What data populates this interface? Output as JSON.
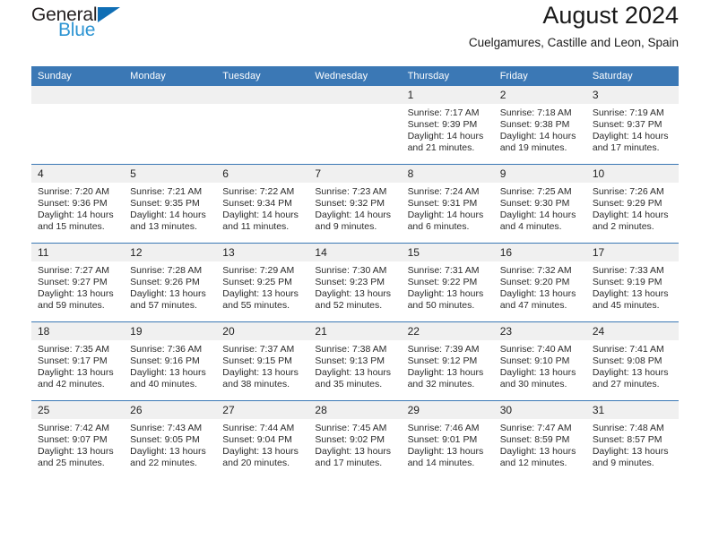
{
  "brand": {
    "name_part1": "General",
    "name_part2": "Blue",
    "triangle_color": "#0f6eb5",
    "blue_text_color": "#2e95d3"
  },
  "header": {
    "title": "August 2024",
    "subtitle": "Cuelgamures, Castille and Leon, Spain"
  },
  "theme": {
    "header_blue": "#3b78b5",
    "daynum_gray": "#f0f0f0",
    "row_divider": "#3b78b5"
  },
  "weekday_headers": [
    "Sunday",
    "Monday",
    "Tuesday",
    "Wednesday",
    "Thursday",
    "Friday",
    "Saturday"
  ],
  "weeks": [
    [
      {
        "day": "",
        "empty": true
      },
      {
        "day": "",
        "empty": true
      },
      {
        "day": "",
        "empty": true
      },
      {
        "day": "",
        "empty": true
      },
      {
        "day": "1",
        "sunrise": "Sunrise: 7:17 AM",
        "sunset": "Sunset: 9:39 PM",
        "daylight": "Daylight: 14 hours and 21 minutes."
      },
      {
        "day": "2",
        "sunrise": "Sunrise: 7:18 AM",
        "sunset": "Sunset: 9:38 PM",
        "daylight": "Daylight: 14 hours and 19 minutes."
      },
      {
        "day": "3",
        "sunrise": "Sunrise: 7:19 AM",
        "sunset": "Sunset: 9:37 PM",
        "daylight": "Daylight: 14 hours and 17 minutes."
      }
    ],
    [
      {
        "day": "4",
        "sunrise": "Sunrise: 7:20 AM",
        "sunset": "Sunset: 9:36 PM",
        "daylight": "Daylight: 14 hours and 15 minutes."
      },
      {
        "day": "5",
        "sunrise": "Sunrise: 7:21 AM",
        "sunset": "Sunset: 9:35 PM",
        "daylight": "Daylight: 14 hours and 13 minutes."
      },
      {
        "day": "6",
        "sunrise": "Sunrise: 7:22 AM",
        "sunset": "Sunset: 9:34 PM",
        "daylight": "Daylight: 14 hours and 11 minutes."
      },
      {
        "day": "7",
        "sunrise": "Sunrise: 7:23 AM",
        "sunset": "Sunset: 9:32 PM",
        "daylight": "Daylight: 14 hours and 9 minutes."
      },
      {
        "day": "8",
        "sunrise": "Sunrise: 7:24 AM",
        "sunset": "Sunset: 9:31 PM",
        "daylight": "Daylight: 14 hours and 6 minutes."
      },
      {
        "day": "9",
        "sunrise": "Sunrise: 7:25 AM",
        "sunset": "Sunset: 9:30 PM",
        "daylight": "Daylight: 14 hours and 4 minutes."
      },
      {
        "day": "10",
        "sunrise": "Sunrise: 7:26 AM",
        "sunset": "Sunset: 9:29 PM",
        "daylight": "Daylight: 14 hours and 2 minutes."
      }
    ],
    [
      {
        "day": "11",
        "sunrise": "Sunrise: 7:27 AM",
        "sunset": "Sunset: 9:27 PM",
        "daylight": "Daylight: 13 hours and 59 minutes."
      },
      {
        "day": "12",
        "sunrise": "Sunrise: 7:28 AM",
        "sunset": "Sunset: 9:26 PM",
        "daylight": "Daylight: 13 hours and 57 minutes."
      },
      {
        "day": "13",
        "sunrise": "Sunrise: 7:29 AM",
        "sunset": "Sunset: 9:25 PM",
        "daylight": "Daylight: 13 hours and 55 minutes."
      },
      {
        "day": "14",
        "sunrise": "Sunrise: 7:30 AM",
        "sunset": "Sunset: 9:23 PM",
        "daylight": "Daylight: 13 hours and 52 minutes."
      },
      {
        "day": "15",
        "sunrise": "Sunrise: 7:31 AM",
        "sunset": "Sunset: 9:22 PM",
        "daylight": "Daylight: 13 hours and 50 minutes."
      },
      {
        "day": "16",
        "sunrise": "Sunrise: 7:32 AM",
        "sunset": "Sunset: 9:20 PM",
        "daylight": "Daylight: 13 hours and 47 minutes."
      },
      {
        "day": "17",
        "sunrise": "Sunrise: 7:33 AM",
        "sunset": "Sunset: 9:19 PM",
        "daylight": "Daylight: 13 hours and 45 minutes."
      }
    ],
    [
      {
        "day": "18",
        "sunrise": "Sunrise: 7:35 AM",
        "sunset": "Sunset: 9:17 PM",
        "daylight": "Daylight: 13 hours and 42 minutes."
      },
      {
        "day": "19",
        "sunrise": "Sunrise: 7:36 AM",
        "sunset": "Sunset: 9:16 PM",
        "daylight": "Daylight: 13 hours and 40 minutes."
      },
      {
        "day": "20",
        "sunrise": "Sunrise: 7:37 AM",
        "sunset": "Sunset: 9:15 PM",
        "daylight": "Daylight: 13 hours and 38 minutes."
      },
      {
        "day": "21",
        "sunrise": "Sunrise: 7:38 AM",
        "sunset": "Sunset: 9:13 PM",
        "daylight": "Daylight: 13 hours and 35 minutes."
      },
      {
        "day": "22",
        "sunrise": "Sunrise: 7:39 AM",
        "sunset": "Sunset: 9:12 PM",
        "daylight": "Daylight: 13 hours and 32 minutes."
      },
      {
        "day": "23",
        "sunrise": "Sunrise: 7:40 AM",
        "sunset": "Sunset: 9:10 PM",
        "daylight": "Daylight: 13 hours and 30 minutes."
      },
      {
        "day": "24",
        "sunrise": "Sunrise: 7:41 AM",
        "sunset": "Sunset: 9:08 PM",
        "daylight": "Daylight: 13 hours and 27 minutes."
      }
    ],
    [
      {
        "day": "25",
        "sunrise": "Sunrise: 7:42 AM",
        "sunset": "Sunset: 9:07 PM",
        "daylight": "Daylight: 13 hours and 25 minutes."
      },
      {
        "day": "26",
        "sunrise": "Sunrise: 7:43 AM",
        "sunset": "Sunset: 9:05 PM",
        "daylight": "Daylight: 13 hours and 22 minutes."
      },
      {
        "day": "27",
        "sunrise": "Sunrise: 7:44 AM",
        "sunset": "Sunset: 9:04 PM",
        "daylight": "Daylight: 13 hours and 20 minutes."
      },
      {
        "day": "28",
        "sunrise": "Sunrise: 7:45 AM",
        "sunset": "Sunset: 9:02 PM",
        "daylight": "Daylight: 13 hours and 17 minutes."
      },
      {
        "day": "29",
        "sunrise": "Sunrise: 7:46 AM",
        "sunset": "Sunset: 9:01 PM",
        "daylight": "Daylight: 13 hours and 14 minutes."
      },
      {
        "day": "30",
        "sunrise": "Sunrise: 7:47 AM",
        "sunset": "Sunset: 8:59 PM",
        "daylight": "Daylight: 13 hours and 12 minutes."
      },
      {
        "day": "31",
        "sunrise": "Sunrise: 7:48 AM",
        "sunset": "Sunset: 8:57 PM",
        "daylight": "Daylight: 13 hours and 9 minutes."
      }
    ]
  ]
}
